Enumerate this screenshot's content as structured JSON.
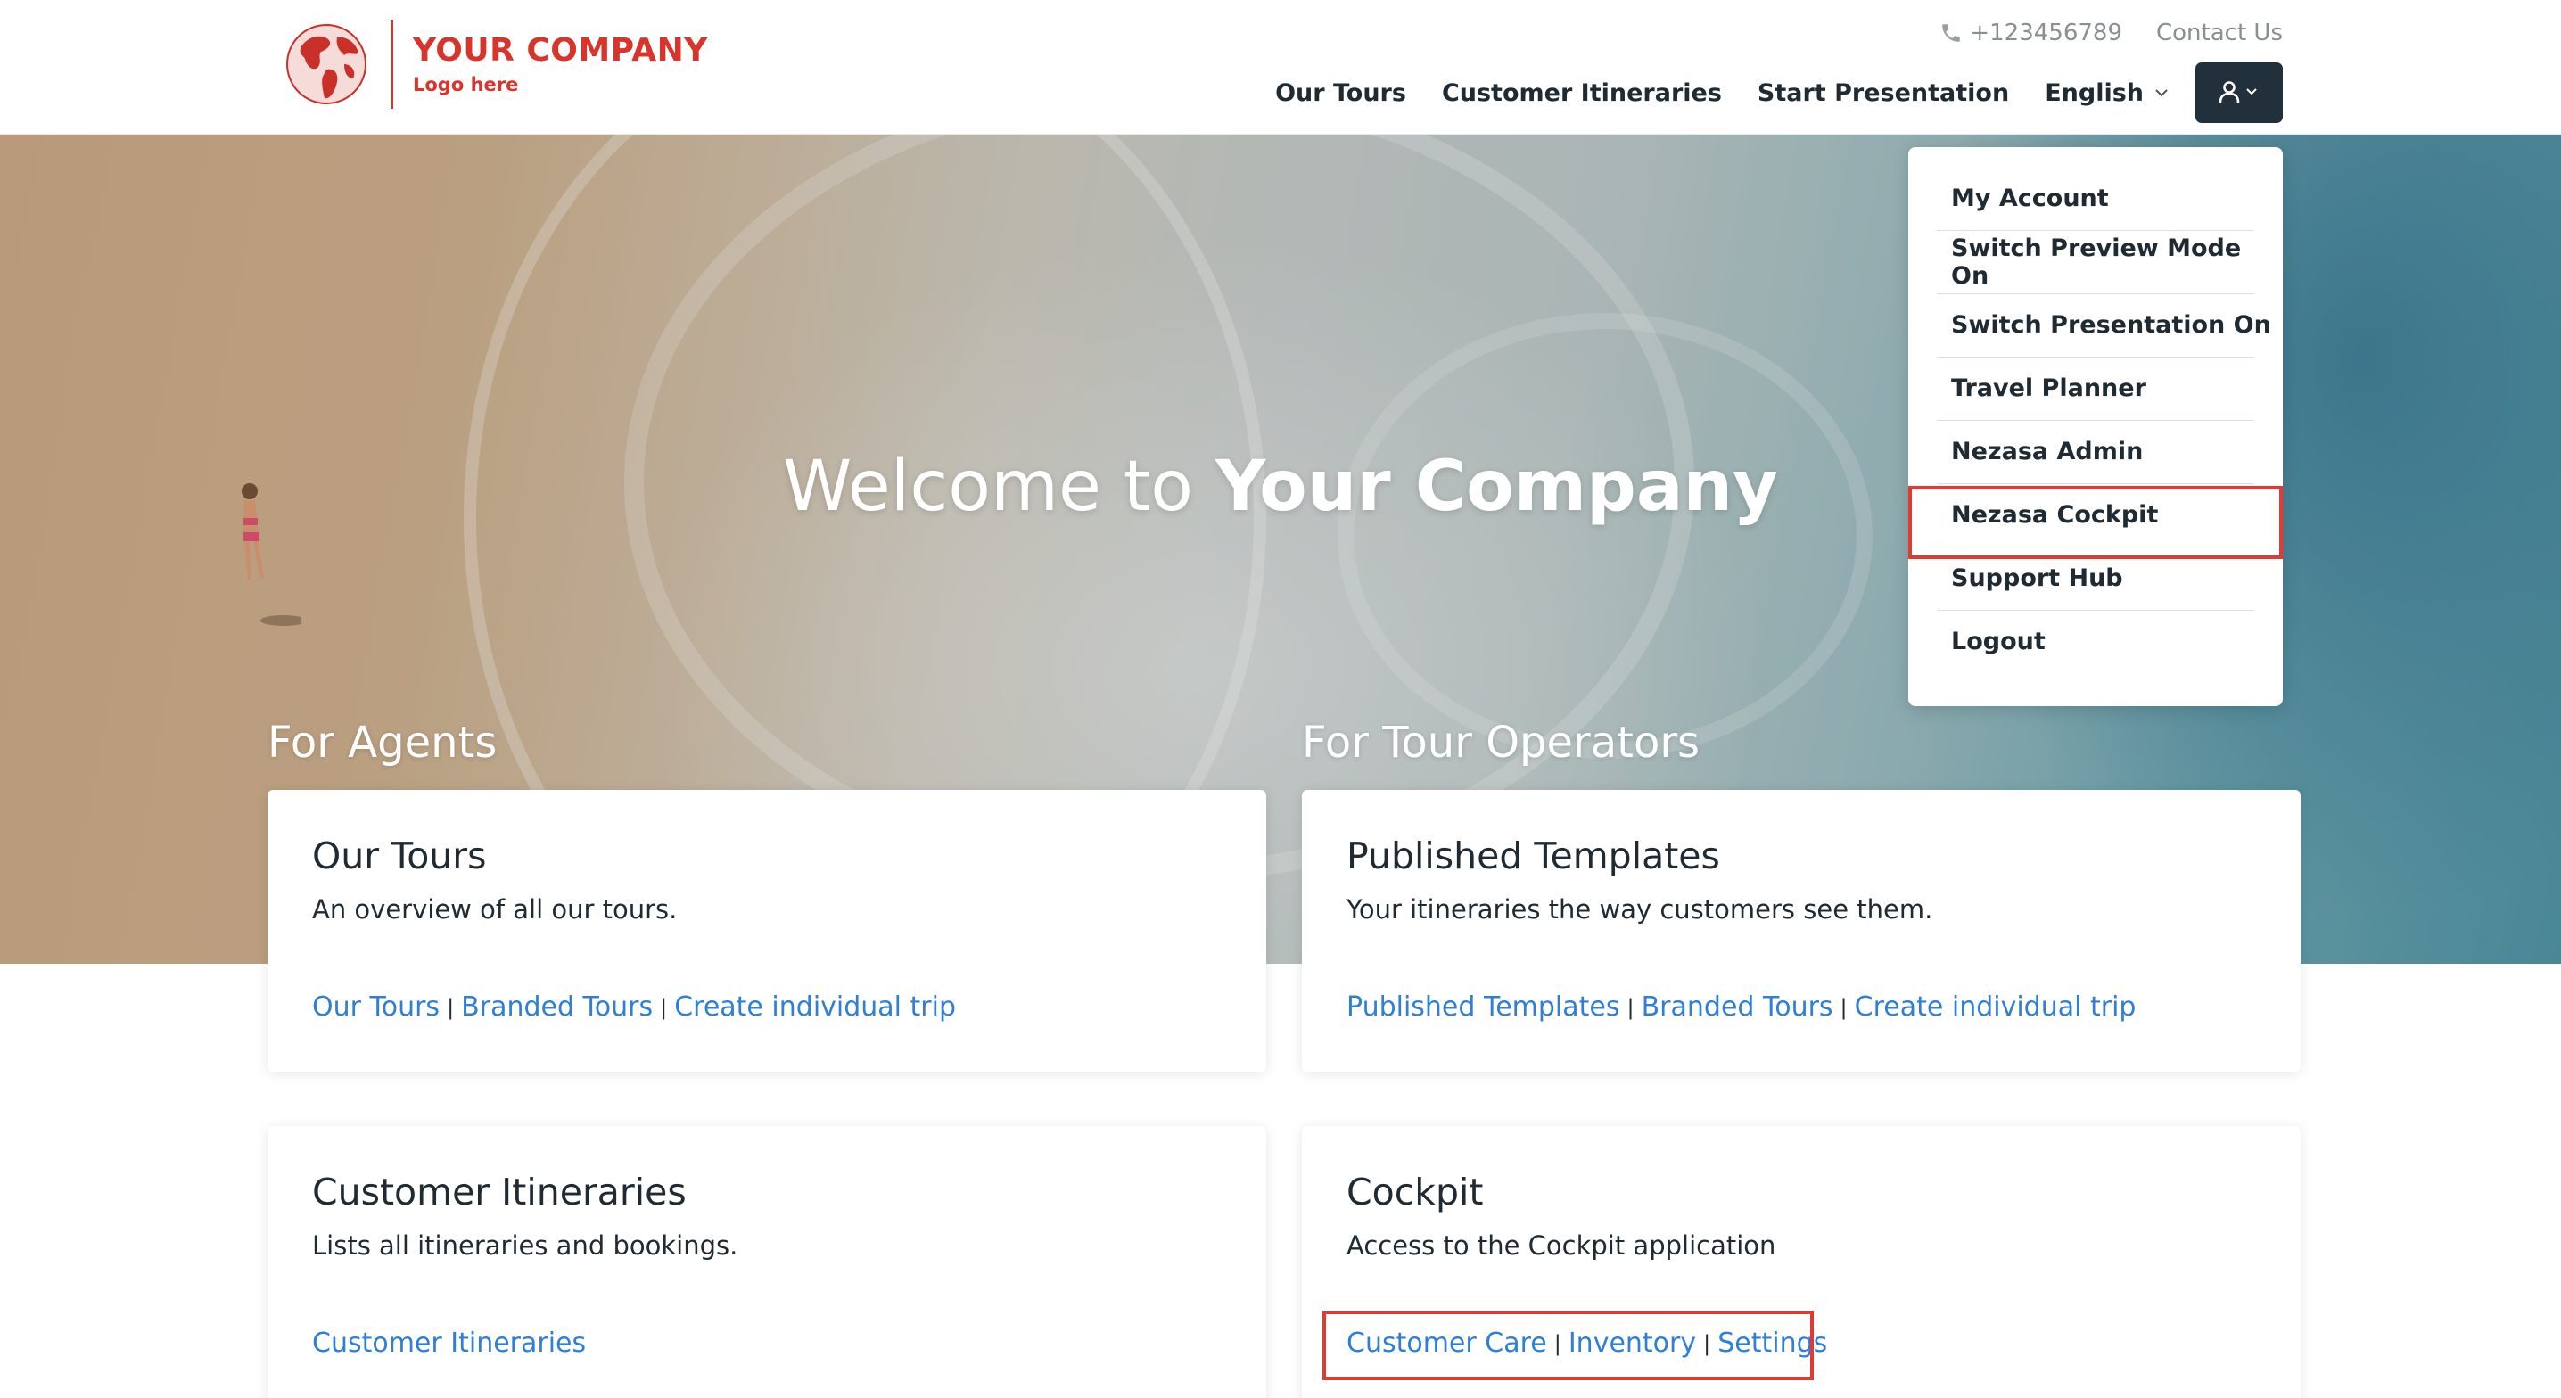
{
  "logo": {
    "company": "YOUR COMPANY",
    "tagline": "Logo here"
  },
  "topbar": {
    "phone": "+123456789",
    "contact": "Contact Us"
  },
  "nav": {
    "items": [
      "Our Tours",
      "Customer Itineraries",
      "Start Presentation"
    ],
    "language": "English"
  },
  "user_menu": {
    "items": [
      "My Account",
      "Switch Preview Mode On",
      "Switch Presentation On",
      "Travel Planner",
      "Nezasa Admin",
      "Nezasa Cockpit",
      "Support Hub",
      "Logout"
    ]
  },
  "hero": {
    "title_prefix": "Welcome to",
    "title_bold": "Your Company"
  },
  "sections": {
    "agents": "For Agents",
    "operators": "For Tour Operators"
  },
  "cards": {
    "our_tours": {
      "title": "Our Tours",
      "desc": "An overview of all our tours.",
      "links": [
        "Our Tours",
        "Branded Tours",
        "Create individual trip"
      ]
    },
    "published": {
      "title": "Published Templates",
      "desc": "Your itineraries the way customers see them.",
      "links": [
        "Published Templates",
        "Branded Tours",
        "Create individual trip"
      ]
    },
    "itineraries": {
      "title": "Customer Itineraries",
      "desc": "Lists all itineraries and bookings.",
      "links": [
        "Customer Itineraries"
      ]
    },
    "cockpit": {
      "title": "Cockpit",
      "desc": "Access to the Cockpit application",
      "links": [
        "Customer Care",
        "Inventory",
        "Settings"
      ]
    }
  },
  "colors": {
    "brand_red": "#d9342b",
    "link_blue": "#2f7fd6",
    "dark": "#22303b",
    "highlight": "#e03b32"
  },
  "icons": {
    "phone": "phone-icon",
    "user": "user-icon",
    "chevron": "chevron-down-icon",
    "globe": "globe-icon"
  }
}
